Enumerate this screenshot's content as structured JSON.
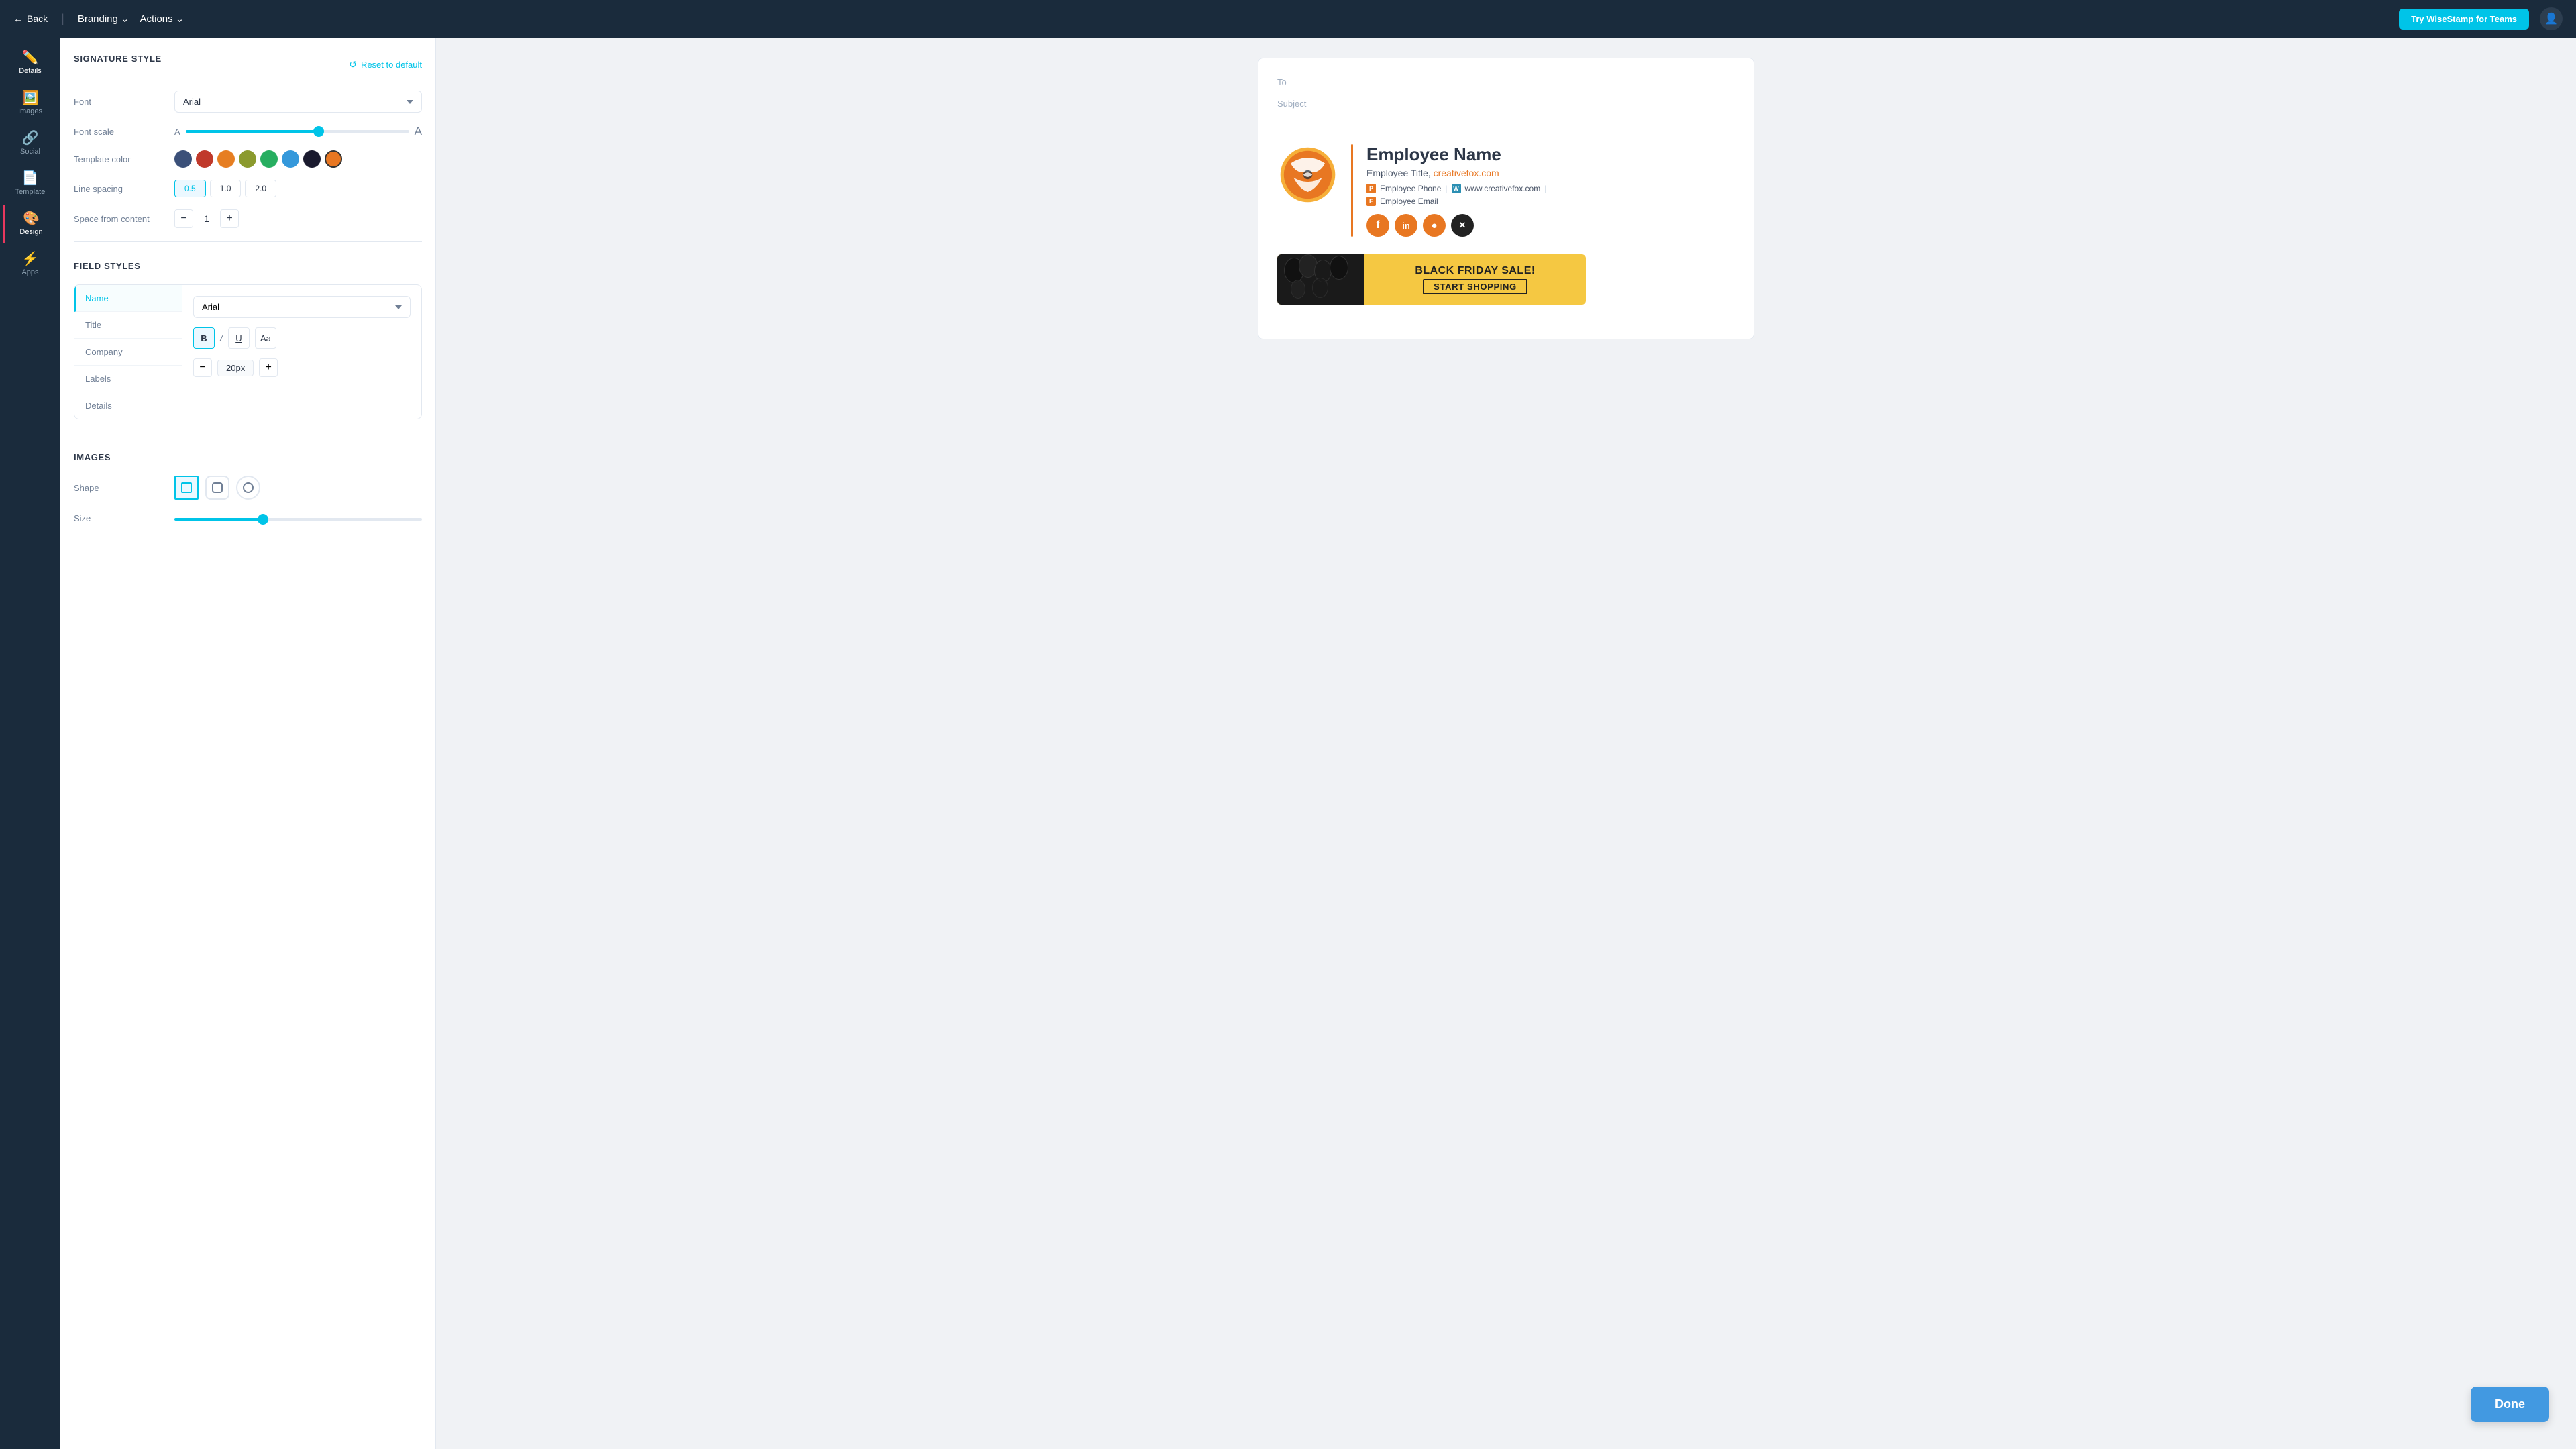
{
  "topnav": {
    "back_label": "Back",
    "branding_label": "Branding",
    "actions_label": "Actions",
    "try_btn_label": "Try WiseStamp for Teams"
  },
  "sidebar": {
    "items": [
      {
        "id": "details",
        "label": "Details",
        "icon": "✏️"
      },
      {
        "id": "images",
        "label": "Images",
        "icon": "🖼️"
      },
      {
        "id": "social",
        "label": "Social",
        "icon": "🔗"
      },
      {
        "id": "template",
        "label": "Template",
        "icon": "📄"
      },
      {
        "id": "design",
        "label": "Design",
        "icon": "🎨"
      },
      {
        "id": "apps",
        "label": "Apps",
        "icon": "⚡"
      }
    ]
  },
  "signature_style": {
    "section_title": "SIGNATURE STYLE",
    "reset_label": "Reset to default",
    "font_label": "Font",
    "font_value": "Arial",
    "font_scale_label": "Font scale",
    "font_scale_small": "A",
    "font_scale_large": "A",
    "template_color_label": "Template color",
    "colors": [
      {
        "hex": "#3b5079",
        "label": "dark blue"
      },
      {
        "hex": "#c0392b",
        "label": "red"
      },
      {
        "hex": "#e67e22",
        "label": "orange"
      },
      {
        "hex": "#8b9a2e",
        "label": "olive"
      },
      {
        "hex": "#27ae60",
        "label": "green"
      },
      {
        "hex": "#3498db",
        "label": "blue"
      },
      {
        "hex": "#1a1a2e",
        "label": "dark"
      },
      {
        "hex": "#e87722",
        "label": "orange-selected",
        "selected": true
      }
    ],
    "line_spacing_label": "Line spacing",
    "spacing_options": [
      "0.5",
      "1.0",
      "2.0"
    ],
    "spacing_active": "0.5",
    "space_from_content_label": "Space from content",
    "space_from_content_value": "1"
  },
  "field_styles": {
    "section_title": "FIELD STYLES",
    "fields": [
      {
        "id": "name",
        "label": "Name",
        "active": true
      },
      {
        "id": "title",
        "label": "Title",
        "active": false
      },
      {
        "id": "company",
        "label": "Company",
        "active": false
      },
      {
        "id": "labels",
        "label": "Labels",
        "active": false
      },
      {
        "id": "details",
        "label": "Details",
        "active": false
      }
    ],
    "font_value": "Arial",
    "font_size_value": "20px"
  },
  "images": {
    "section_title": "IMAGES",
    "shape_label": "Shape",
    "size_label": "Size"
  },
  "preview": {
    "to_placeholder": "To",
    "subject_placeholder": "Subject",
    "employee_name": "Employee Name",
    "employee_title": "Employee Title, ",
    "employee_website": "creativefox.com",
    "phone_label": "P",
    "phone_value": "Employee Phone",
    "web_label": "W",
    "web_value": "www.creativefox.com",
    "email_label": "E",
    "email_value": "Employee Email",
    "social_icons": [
      "f",
      "in",
      "📷",
      "✕"
    ],
    "banner_headline": "BLACK FRIDAY SALE!",
    "banner_cta": "START SHOPPING"
  },
  "done_btn_label": "Done"
}
